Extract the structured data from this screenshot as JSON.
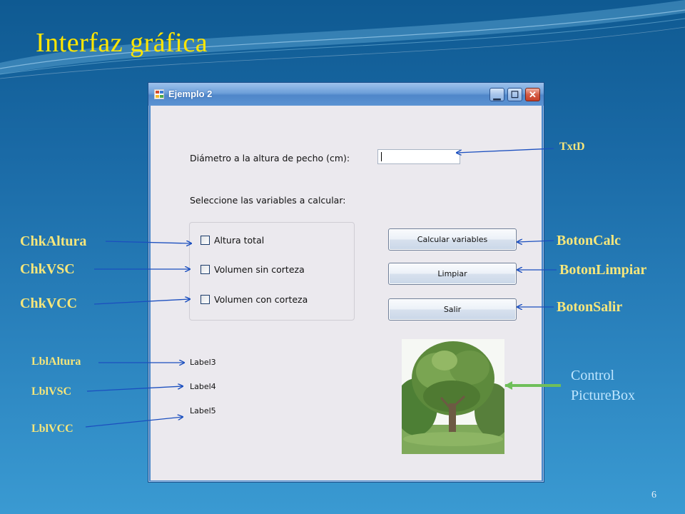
{
  "slide": {
    "title": "Interfaz gráfica",
    "page_number": "6"
  },
  "window": {
    "title": "Ejemplo 2",
    "controls": {
      "minimize": "▁",
      "maximize": "☐",
      "close": "✕"
    }
  },
  "form": {
    "diameter_label": "Diámetro a la altura de pecho (cm):",
    "diameter_value": "",
    "select_label": "Seleccione las variables a calcular:",
    "checkboxes": [
      {
        "label": "Altura total",
        "checked": false
      },
      {
        "label": "Volumen sin corteza",
        "checked": false
      },
      {
        "label": "Volumen con corteza",
        "checked": false
      }
    ],
    "buttons": {
      "calc": "Calcular variables",
      "clear": "Limpiar",
      "exit": "Salir"
    },
    "result_labels": [
      "Label3",
      "Label4",
      "Label5"
    ]
  },
  "annotations": {
    "txtd": "TxtD",
    "chk_altura": "ChkAltura",
    "chk_vsc": "ChkVSC",
    "chk_vcc": "ChkVCC",
    "boton_calc": "BotonCalc",
    "boton_limpiar": "BotonLimpiar",
    "boton_salir": "BotonSalir",
    "lbl_altura": "LblAltura",
    "lbl_vsc": "LblVSC",
    "lbl_vcc": "LblVCC",
    "picturebox_line1": "Control",
    "picturebox_line2": "PictureBox"
  },
  "colors": {
    "title": "#ffe600",
    "callout": "#f6e67b",
    "picturebox_callout": "#bfe6ff",
    "arrow": "#1b4fbf",
    "picturebox_arrow": "#6fbf5a"
  }
}
